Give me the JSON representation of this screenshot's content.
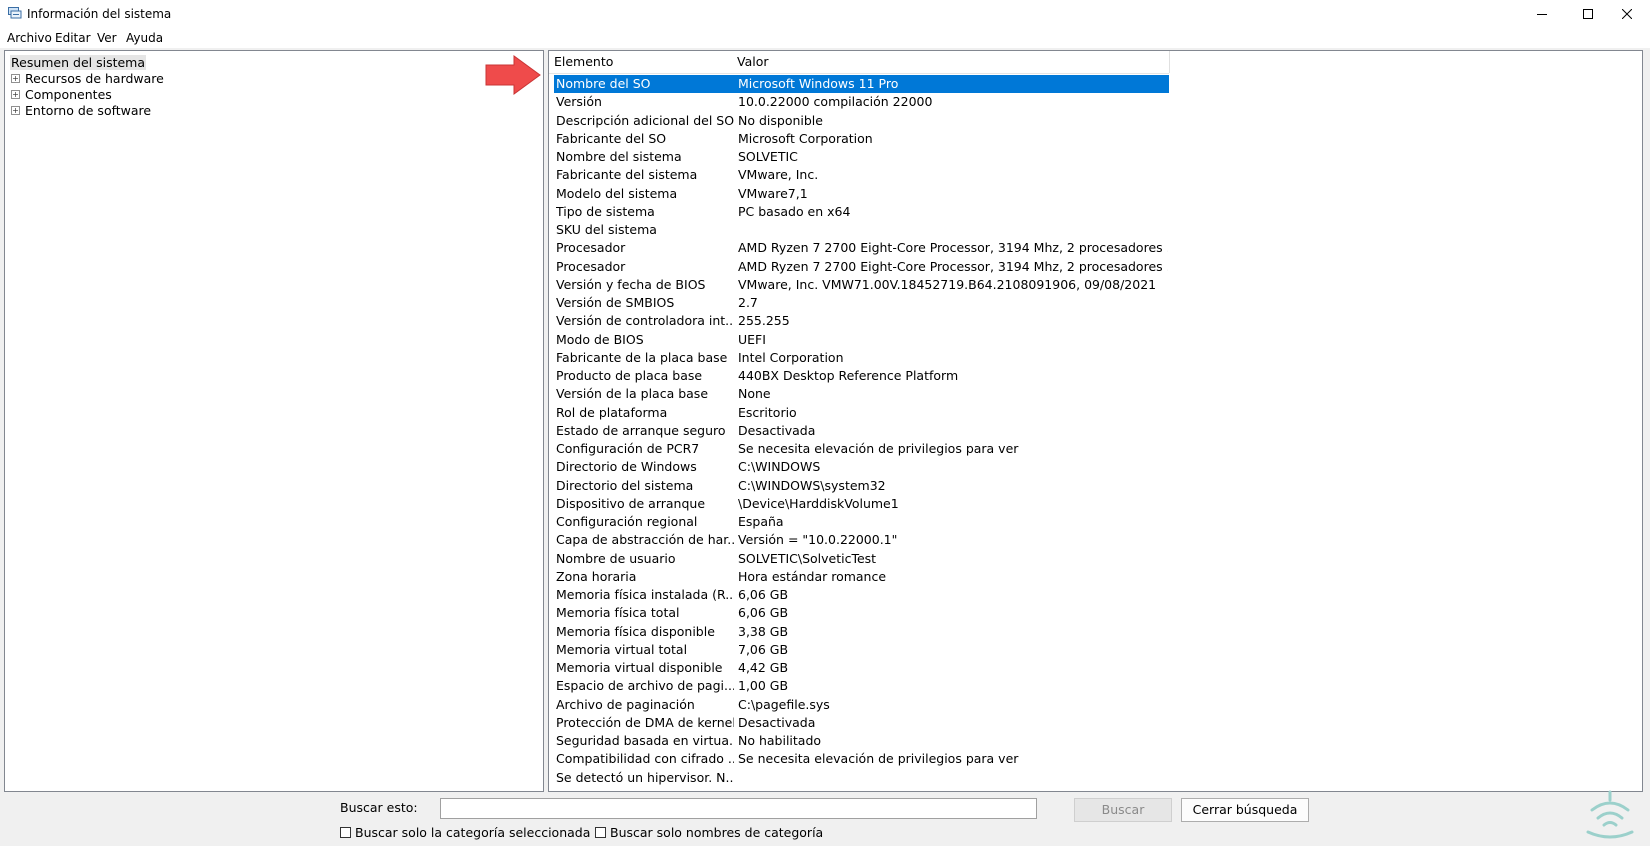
{
  "window": {
    "title": "Información del sistema",
    "controls": [
      "minimize-icon",
      "maximize-icon",
      "close-icon"
    ]
  },
  "menu": [
    "Archivo",
    "Editar",
    "Ver",
    "Ayuda"
  ],
  "tree": {
    "root": "Resumen del sistema",
    "items": [
      "Recursos de hardware",
      "Componentes",
      "Entorno de software"
    ],
    "expander_glyph": "+"
  },
  "table": {
    "headers": [
      "Elemento",
      "Valor"
    ],
    "selected_index": 0,
    "selection_color": "#0078d7",
    "rows": [
      {
        "key": "Nombre del SO",
        "value": "Microsoft Windows 11 Pro"
      },
      {
        "key": "Versión",
        "value": "10.0.22000 compilación 22000"
      },
      {
        "key": "Descripción adicional del SO",
        "value": "No disponible"
      },
      {
        "key": "Fabricante del SO",
        "value": "Microsoft Corporation"
      },
      {
        "key": "Nombre del sistema",
        "value": "SOLVETIC"
      },
      {
        "key": "Fabricante del sistema",
        "value": "VMware, Inc."
      },
      {
        "key": "Modelo del sistema",
        "value": "VMware7,1"
      },
      {
        "key": "Tipo de sistema",
        "value": "PC basado en x64"
      },
      {
        "key": "SKU del sistema",
        "value": ""
      },
      {
        "key": "Procesador",
        "value": "AMD Ryzen 7 2700 Eight-Core Processor, 3194 Mhz, 2 procesadores ..."
      },
      {
        "key": "Procesador",
        "value": "AMD Ryzen 7 2700 Eight-Core Processor, 3194 Mhz, 2 procesadores ..."
      },
      {
        "key": "Versión y fecha de BIOS",
        "value": "VMware, Inc. VMW71.00V.18452719.B64.2108091906, 09/08/2021"
      },
      {
        "key": "Versión de SMBIOS",
        "value": "2.7"
      },
      {
        "key": "Versión de controladora int...",
        "value": "255.255"
      },
      {
        "key": "Modo de BIOS",
        "value": "UEFI"
      },
      {
        "key": "Fabricante de la placa base",
        "value": "Intel Corporation"
      },
      {
        "key": "Producto de placa base",
        "value": "440BX Desktop Reference Platform"
      },
      {
        "key": "Versión de la placa base",
        "value": "None"
      },
      {
        "key": "Rol de plataforma",
        "value": "Escritorio"
      },
      {
        "key": "Estado de arranque seguro",
        "value": "Desactivada"
      },
      {
        "key": "Configuración de PCR7",
        "value": "Se necesita elevación de privilegios para ver"
      },
      {
        "key": "Directorio de Windows",
        "value": "C:\\WINDOWS"
      },
      {
        "key": "Directorio del sistema",
        "value": "C:\\WINDOWS\\system32"
      },
      {
        "key": "Dispositivo de arranque",
        "value": "\\Device\\HarddiskVolume1"
      },
      {
        "key": "Configuración regional",
        "value": "España"
      },
      {
        "key": "Capa de abstracción de har...",
        "value": "Versión = \"10.0.22000.1\""
      },
      {
        "key": "Nombre de usuario",
        "value": "SOLVETIC\\SolveticTest"
      },
      {
        "key": "Zona horaria",
        "value": "Hora estándar romance"
      },
      {
        "key": "Memoria física instalada (R...",
        "value": "6,06 GB"
      },
      {
        "key": "Memoria física total",
        "value": "6,06 GB"
      },
      {
        "key": "Memoria física disponible",
        "value": "3,38 GB"
      },
      {
        "key": "Memoria virtual total",
        "value": "7,06 GB"
      },
      {
        "key": "Memoria virtual disponible",
        "value": "4,42 GB"
      },
      {
        "key": "Espacio de archivo de pagi...",
        "value": "1,00 GB"
      },
      {
        "key": "Archivo de paginación",
        "value": "C:\\pagefile.sys"
      },
      {
        "key": "Protección de DMA de kernel",
        "value": "Desactivada"
      },
      {
        "key": "Seguridad basada en virtua...",
        "value": "No habilitado"
      },
      {
        "key": "Compatibilidad con cifrado ...",
        "value": "Se necesita elevación de privilegios para ver"
      },
      {
        "key": "Se detectó un hipervisor. N...",
        "value": ""
      }
    ]
  },
  "annotation": {
    "arrow_color": "#ef4b4b"
  },
  "search": {
    "label": "Buscar esto:",
    "value": "",
    "find_button": "Buscar",
    "close_button": "Cerrar búsqueda",
    "checkbox_selected_category": "Buscar solo la categoría seleccionada",
    "checkbox_category_names": "Buscar solo nombres de categoría",
    "checkbox_selected_category_checked": false,
    "checkbox_category_names_checked": false
  },
  "watermark": {
    "brand": "Solvetic",
    "color": "#9bd0cb"
  }
}
